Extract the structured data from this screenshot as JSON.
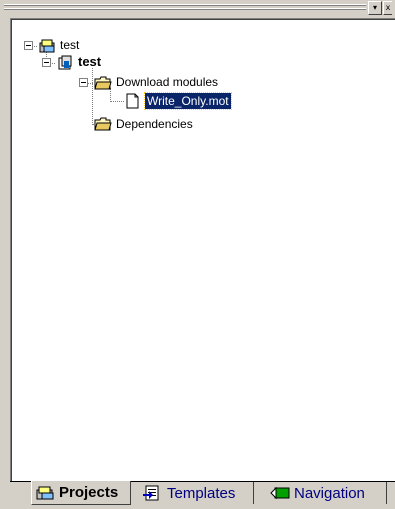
{
  "window": {
    "dropdown_glyph": "▾",
    "close_glyph": "x"
  },
  "tree": {
    "root": {
      "label": "test",
      "icon": "workspace-icon"
    },
    "project": {
      "label": "test",
      "icon": "project-icon"
    },
    "download_folder": {
      "label": "Download modules",
      "icon": "folder-open-icon"
    },
    "file": {
      "label": "Write_Only.mot",
      "icon": "document-icon",
      "selected": true
    },
    "dependencies_folder": {
      "label": "Dependencies",
      "icon": "folder-open-icon"
    }
  },
  "tabs": [
    {
      "label": "Projects",
      "icon": "projects-icon",
      "active": true
    },
    {
      "label": "Templates",
      "icon": "templates-icon",
      "active": false
    },
    {
      "label": "Navigation",
      "icon": "navigation-icon",
      "active": false
    }
  ],
  "colors": {
    "selection_bg": "#0a246a",
    "selection_fg": "#ffffff",
    "panel_bg": "#d4d0c8",
    "inactive_tab_text": "#000080"
  }
}
